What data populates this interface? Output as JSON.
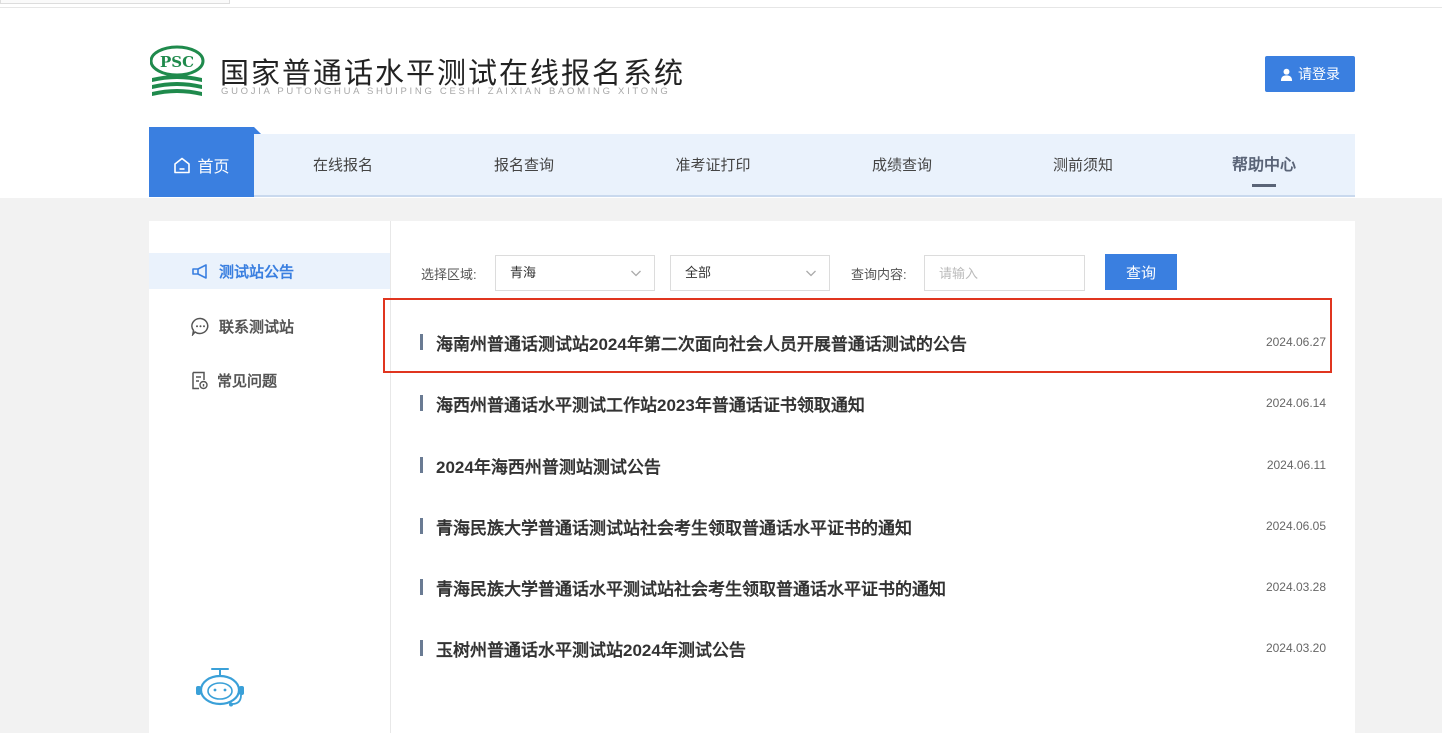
{
  "header": {
    "title": "国家普通话水平测试在线报名系统",
    "subtitle": "GUOJIA PUTONGHUA SHUIPING CESHI ZAIXIAN BAOMING XITONG",
    "logo_text": "PSC",
    "login_label": "请登录"
  },
  "nav": {
    "home": "首页",
    "items": [
      "在线报名",
      "报名查询",
      "准考证打印",
      "成绩查询",
      "测前须知",
      "帮助中心"
    ],
    "active": "帮助中心"
  },
  "sidebar": {
    "items": [
      {
        "label": "测试站公告",
        "icon": "megaphone-icon",
        "active": true
      },
      {
        "label": "联系测试站",
        "icon": "chat-bubble-icon",
        "active": false
      },
      {
        "label": "常见问题",
        "icon": "document-question-icon",
        "active": false
      }
    ]
  },
  "filters": {
    "region_label": "选择区域:",
    "region_value": "青海",
    "category_value": "全部",
    "query_label": "查询内容:",
    "query_placeholder": "请输入",
    "query_button": "查询"
  },
  "announcements": [
    {
      "title": "海南州普通话测试站2024年第二次面向社会人员开展普通话测试的公告",
      "date": "2024.06.27",
      "highlighted": true
    },
    {
      "title": "海西州普通话水平测试工作站2023年普通话证书领取通知",
      "date": "2024.06.14"
    },
    {
      "title": "2024年海西州普测站测试公告",
      "date": "2024.06.11"
    },
    {
      "title": "青海民族大学普通话测试站社会考生领取普通话水平证书的通知",
      "date": "2024.06.05"
    },
    {
      "title": "青海民族大学普通话水平测试站社会考生领取普通话水平证书的通知",
      "date": "2024.03.28"
    },
    {
      "title": "玉树州普通话水平测试站2024年测试公告",
      "date": "2024.03.20"
    }
  ],
  "colors": {
    "accent": "#3a7fe0",
    "nav_bg": "#eaf2fc",
    "logo_green": "#1f8a4c",
    "highlight_border": "#e0351f"
  }
}
